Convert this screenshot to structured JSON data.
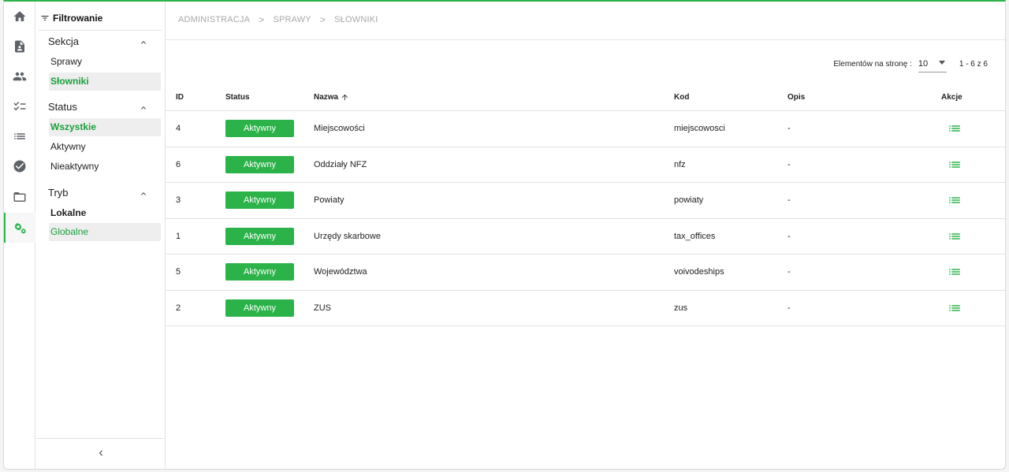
{
  "colors": {
    "accent": "#2bb34a",
    "accent_text": "#1a9f3a"
  },
  "rail": {
    "items": [
      {
        "icon": "home-icon"
      },
      {
        "icon": "document-icon"
      },
      {
        "icon": "people-icon"
      },
      {
        "icon": "checklist-icon"
      },
      {
        "icon": "list-icon"
      },
      {
        "icon": "check-circle-icon"
      },
      {
        "icon": "folder-icon"
      },
      {
        "icon": "settings-gears-icon",
        "active": true
      }
    ]
  },
  "filter": {
    "title": "Filtrowanie",
    "sections": [
      {
        "title": "Sekcja",
        "options": [
          "Sprawy",
          "Słowniki"
        ],
        "selected": "Słowniki"
      },
      {
        "title": "Status",
        "options": [
          "Wszystkie",
          "Aktywny",
          "Nieaktywny"
        ],
        "selected": "Wszystkie"
      },
      {
        "title": "Tryb",
        "options": [
          "Lokalne",
          "Globalne"
        ],
        "selected": "Globalne"
      }
    ]
  },
  "breadcrumb": [
    "ADMINISTRACJA",
    "SPRAWY",
    "SŁOWNIKI"
  ],
  "pager": {
    "label": "Elementów na stronę :",
    "page_size": "10",
    "range": "1 - 6 z 6"
  },
  "table": {
    "headers": {
      "id": "ID",
      "status": "Status",
      "name": "Nazwa",
      "code": "Kod",
      "desc": "Opis",
      "actions": "Akcje"
    },
    "rows": [
      {
        "id": "4",
        "status": "Aktywny",
        "name": "Miejscowości",
        "code": "miejscowosci",
        "desc": "-"
      },
      {
        "id": "6",
        "status": "Aktywny",
        "name": "Oddziały NFZ",
        "code": "nfz",
        "desc": "-"
      },
      {
        "id": "3",
        "status": "Aktywny",
        "name": "Powiaty",
        "code": "powiaty",
        "desc": "-"
      },
      {
        "id": "1",
        "status": "Aktywny",
        "name": "Urzędy skarbowe",
        "code": "tax_offices",
        "desc": "-"
      },
      {
        "id": "5",
        "status": "Aktywny",
        "name": "Województwa",
        "code": "voivodeships",
        "desc": "-"
      },
      {
        "id": "2",
        "status": "Aktywny",
        "name": "ZUS",
        "code": "zus",
        "desc": "-"
      }
    ]
  }
}
